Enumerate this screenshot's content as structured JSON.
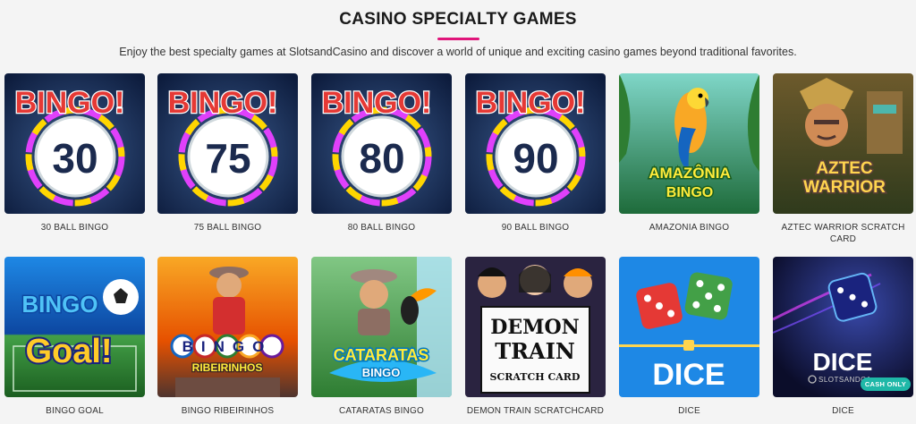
{
  "header": {
    "title": "CASINO SPECIALTY GAMES",
    "subtitle": "Enjoy the best specialty games at SlotsandCasino and discover a world of unique and exciting casino games beyond traditional favorites.",
    "accent_color": "#e0157a"
  },
  "games": [
    {
      "caption": "30 BALL BINGO",
      "logo": "BINGO!",
      "number": "30"
    },
    {
      "caption": "75 BALL BINGO",
      "logo": "BINGO!",
      "number": "75"
    },
    {
      "caption": "80 BALL BINGO",
      "logo": "BINGO!",
      "number": "80"
    },
    {
      "caption": "90 BALL BINGO",
      "logo": "BINGO!",
      "number": "90"
    },
    {
      "caption": "AMAZONIA BINGO",
      "logo_line1": "AMAZÔNIA",
      "logo_line2": "BINGO"
    },
    {
      "caption": "AZTEC WARRIOR SCRATCH CARD",
      "logo_line1": "AZTEC",
      "logo_line2": "WARRIOR"
    },
    {
      "caption": "BINGO GOAL",
      "logo_line1": "BINGO",
      "logo_line2": "Goal!"
    },
    {
      "caption": "BINGO RIBEIRINHOS",
      "logo_line1": "BINGO",
      "logo_line2": "RIBEIRINHOS"
    },
    {
      "caption": "CATARATAS BINGO",
      "logo_line1": "CATARATAS",
      "logo_line2": "BINGO"
    },
    {
      "caption": "DEMON TRAIN SCRATCHCARD",
      "logo_line1": "DEMON",
      "logo_line2": "TRAIN",
      "logo_line3": "SCRATCH CARD"
    },
    {
      "caption": "DICE",
      "logo": "DICE"
    },
    {
      "caption": "DICE",
      "logo": "DICE",
      "brand": "SLOTSANDCA",
      "badge": "CASH ONLY"
    }
  ]
}
